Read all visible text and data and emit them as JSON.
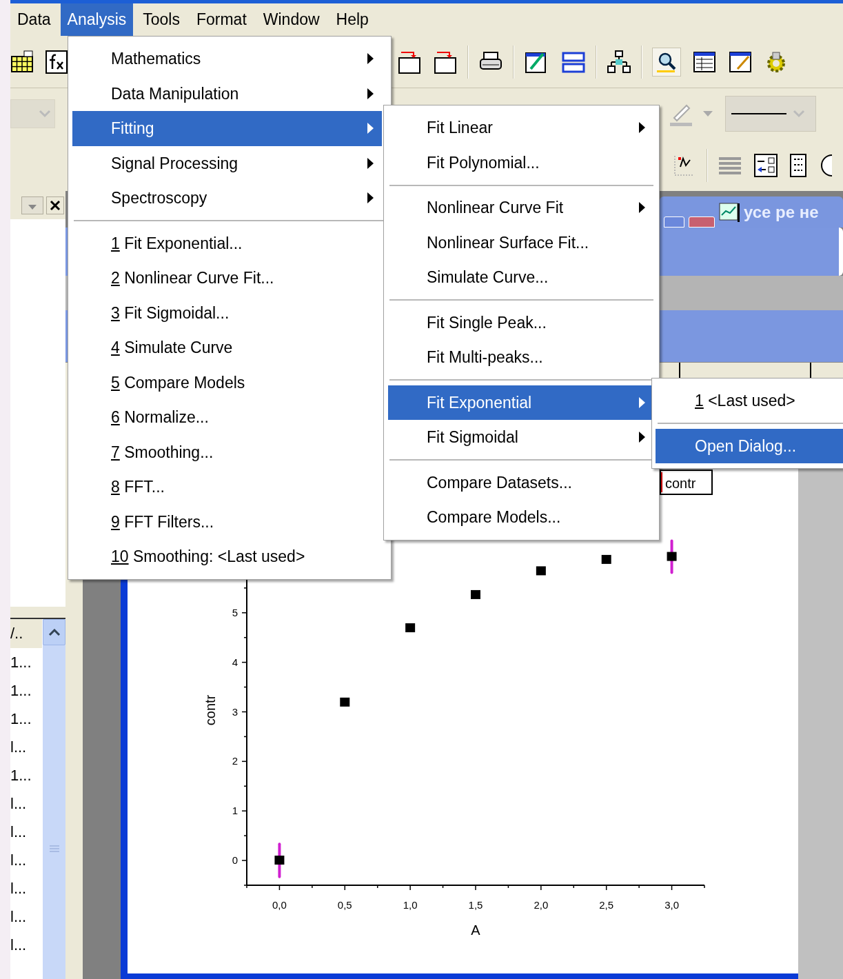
{
  "menu_bar": [
    {
      "label": "Data",
      "selected": false
    },
    {
      "label": "Analysis",
      "selected": true
    },
    {
      "label": "Tools",
      "selected": false
    },
    {
      "label": "Format",
      "selected": false
    },
    {
      "label": "Window",
      "selected": false
    },
    {
      "label": "Help",
      "selected": false
    }
  ],
  "analysis_menu": [
    {
      "kind": "item",
      "label": "Mathematics",
      "submenu": true,
      "selected": false
    },
    {
      "kind": "item",
      "label": "Data Manipulation",
      "submenu": true,
      "selected": false
    },
    {
      "kind": "item",
      "label": "Fitting",
      "submenu": true,
      "selected": true
    },
    {
      "kind": "item",
      "label": "Signal Processing",
      "submenu": true,
      "selected": false
    },
    {
      "kind": "item",
      "label": "Spectroscopy",
      "submenu": true,
      "selected": false
    },
    {
      "kind": "separator"
    },
    {
      "kind": "item",
      "mnemonic": "1",
      "label": "Fit Exponential...",
      "submenu": false,
      "selected": false
    },
    {
      "kind": "item",
      "mnemonic": "2",
      "label": "Nonlinear Curve Fit...",
      "submenu": false,
      "selected": false
    },
    {
      "kind": "item",
      "mnemonic": "3",
      "label": "Fit Sigmoidal...",
      "submenu": false,
      "selected": false
    },
    {
      "kind": "item",
      "mnemonic": "4",
      "label": "Simulate Curve",
      "submenu": false,
      "selected": false
    },
    {
      "kind": "item",
      "mnemonic": "5",
      "label": "Compare Models",
      "submenu": false,
      "selected": false
    },
    {
      "kind": "item",
      "mnemonic": "6",
      "label": "Normalize...",
      "submenu": false,
      "selected": false
    },
    {
      "kind": "item",
      "mnemonic": "7",
      "label": "Smoothing...",
      "submenu": false,
      "selected": false
    },
    {
      "kind": "item",
      "mnemonic": "8",
      "label": "FFT...",
      "submenu": false,
      "selected": false
    },
    {
      "kind": "item",
      "mnemonic": "9",
      "label": "FFT Filters...",
      "submenu": false,
      "selected": false
    },
    {
      "kind": "item",
      "mnemonic": "10",
      "label": "Smoothing: <Last used>",
      "submenu": false,
      "selected": false
    }
  ],
  "fitting_menu": [
    {
      "kind": "item",
      "label": "Fit Linear",
      "submenu": true,
      "selected": false
    },
    {
      "kind": "item",
      "label": "Fit Polynomial...",
      "submenu": false,
      "selected": false
    },
    {
      "kind": "separator"
    },
    {
      "kind": "item",
      "label": "Nonlinear Curve Fit",
      "submenu": true,
      "selected": false
    },
    {
      "kind": "item",
      "label": "Nonlinear Surface Fit...",
      "submenu": false,
      "selected": false
    },
    {
      "kind": "item",
      "label": "Simulate Curve...",
      "submenu": false,
      "selected": false
    },
    {
      "kind": "separator"
    },
    {
      "kind": "item",
      "label": "Fit Single Peak...",
      "submenu": false,
      "selected": false
    },
    {
      "kind": "item",
      "label": "Fit Multi-peaks...",
      "submenu": false,
      "selected": false
    },
    {
      "kind": "separator"
    },
    {
      "kind": "item",
      "label": "Fit Exponential",
      "submenu": true,
      "selected": true
    },
    {
      "kind": "item",
      "label": "Fit Sigmoidal",
      "submenu": true,
      "selected": false
    },
    {
      "kind": "separator"
    },
    {
      "kind": "item",
      "label": "Compare Datasets...",
      "submenu": false,
      "selected": false
    },
    {
      "kind": "item",
      "label": "Compare Models...",
      "submenu": false,
      "selected": false
    }
  ],
  "fit_exponential_menu": [
    {
      "kind": "item",
      "mnemonic": "1",
      "label": "<Last used>",
      "selected": false
    },
    {
      "kind": "separator"
    },
    {
      "kind": "item",
      "label": "Open Dialog...",
      "selected": true
    }
  ],
  "background_window": {
    "title": "усе ре не"
  },
  "project_explorer": {
    "header": "/..",
    "rows": [
      "1...",
      "1...",
      "1...",
      "l...",
      "1...",
      "l...",
      "l...",
      "l...",
      "l...",
      "l...",
      "l..."
    ]
  },
  "graph": {
    "chart_data": {
      "type": "scatter",
      "xlabel": "A",
      "ylabel": "contr",
      "xlim": [
        -0.25,
        3.25
      ],
      "ylim": [
        -0.5,
        6.5
      ],
      "xticks": [
        {
          "value": 0,
          "label": "0,0"
        },
        {
          "value": 0.5,
          "label": "0,5"
        },
        {
          "value": 1,
          "label": "1,0"
        },
        {
          "value": 1.5,
          "label": "1,5"
        },
        {
          "value": 2,
          "label": "2,0"
        },
        {
          "value": 2.5,
          "label": "2,5"
        },
        {
          "value": 3,
          "label": "3,0"
        }
      ],
      "yticks": [
        0,
        1,
        2,
        3,
        4,
        5
      ],
      "series": [
        {
          "name": "contr",
          "color": "#000000",
          "x": [
            0,
            0.5,
            1,
            1.5,
            2,
            2.5,
            3
          ],
          "values": [
            0,
            3.19,
            4.69,
            5.36,
            5.84,
            6.07,
            6.13
          ],
          "errors": [
            0.33,
            null,
            null,
            null,
            null,
            null,
            0.32
          ]
        }
      ]
    }
  }
}
